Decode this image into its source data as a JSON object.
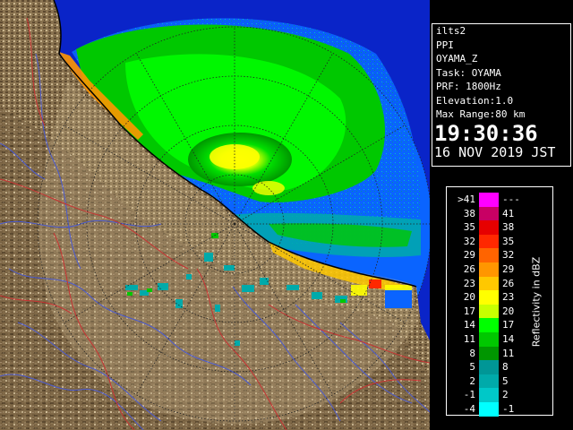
{
  "info": {
    "site": "ilts2",
    "product": "PPI",
    "radar": "OYAMA_Z",
    "task": "Task: OYAMA",
    "prf": "PRF: 1800Hz",
    "elevation": "Elevation:1.0",
    "max_range": "Max Range:80 km",
    "time": "19:30:36",
    "date": "16 NOV 2019 JST"
  },
  "legend": {
    "title": "Reflectivity in dBZ",
    "rows": [
      {
        "low": ">41",
        "high": "---",
        "color": "#ff00ff"
      },
      {
        "low": "38",
        "high": "41",
        "color": "#c80064"
      },
      {
        "low": "35",
        "high": "38",
        "color": "#e60000"
      },
      {
        "low": "32",
        "high": "35",
        "color": "#ff2800"
      },
      {
        "low": "29",
        "high": "32",
        "color": "#ff6400"
      },
      {
        "low": "26",
        "high": "29",
        "color": "#ff9600"
      },
      {
        "low": "23",
        "high": "26",
        "color": "#ffc800"
      },
      {
        "low": "20",
        "high": "23",
        "color": "#ffff00"
      },
      {
        "low": "17",
        "high": "20",
        "color": "#c8ff00"
      },
      {
        "low": "14",
        "high": "17",
        "color": "#00ff00"
      },
      {
        "low": "11",
        "high": "14",
        "color": "#00c800"
      },
      {
        "low": "8",
        "high": "11",
        "color": "#009600"
      },
      {
        "low": "5",
        "high": "8",
        "color": "#009696"
      },
      {
        "low": "2",
        "high": "5",
        "color": "#00aaaa"
      },
      {
        "low": "-1",
        "high": "2",
        "color": "#00c8c8"
      },
      {
        "low": "-4",
        "high": "-1",
        "color": "#00ffff"
      }
    ]
  },
  "colors": {
    "sea": "#0a24c8",
    "coverage": "#0a64ff",
    "land": "#8a7350",
    "rivers": "#4a5ad0",
    "boundaries": "#c83232"
  }
}
